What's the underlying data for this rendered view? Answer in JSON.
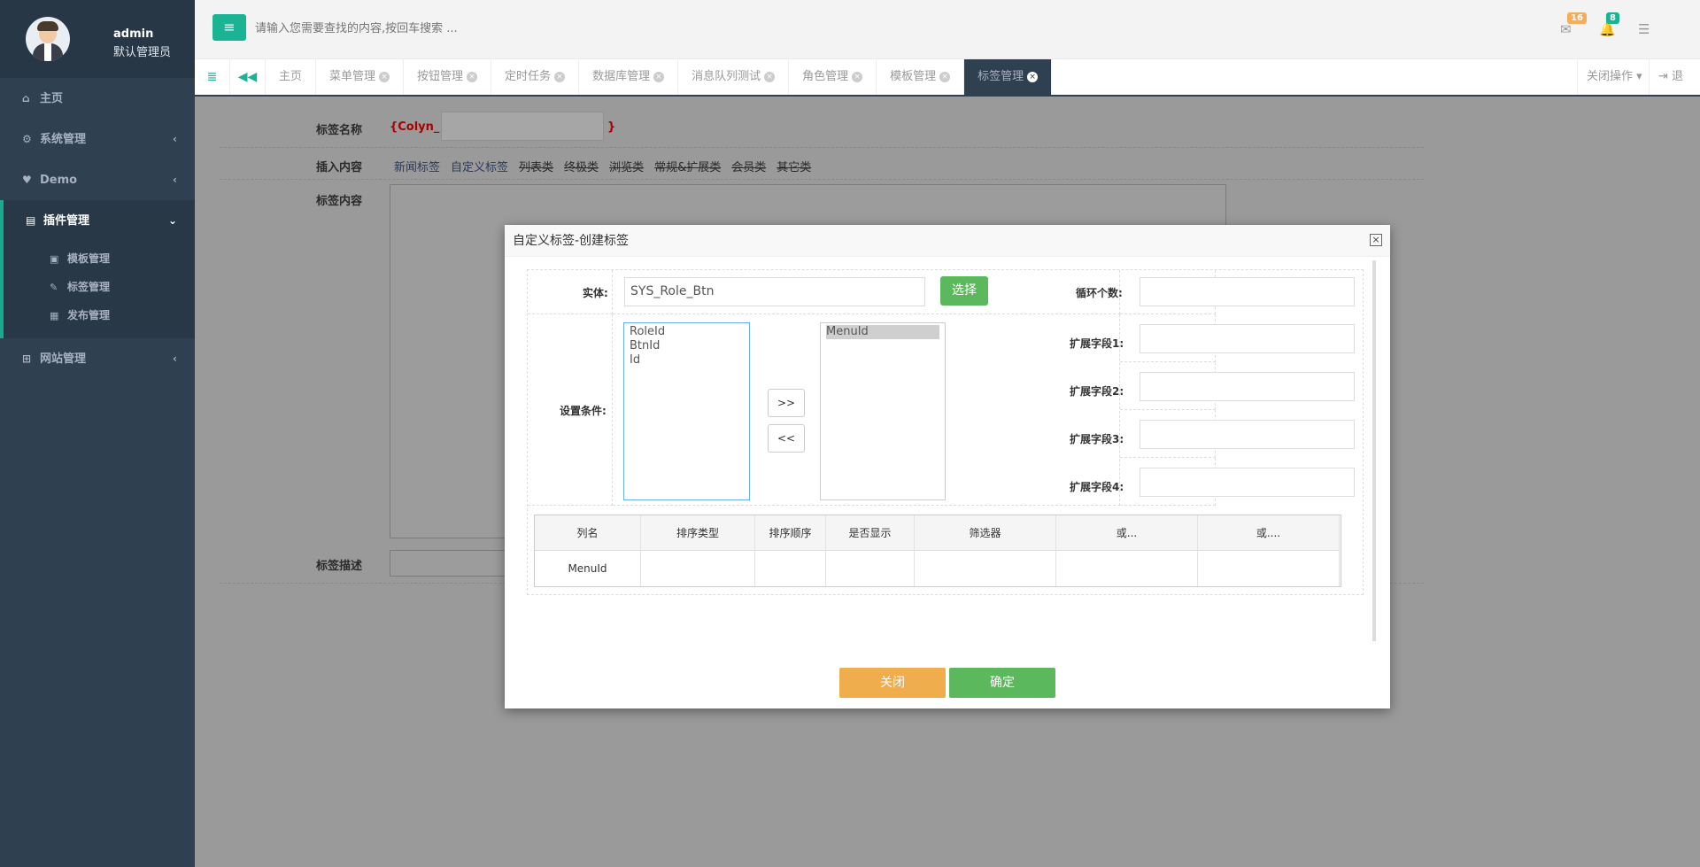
{
  "profile": {
    "name": "admin",
    "role": "默认管理员"
  },
  "sidebar": {
    "items": [
      {
        "label": "主页",
        "icon": "home-icon"
      },
      {
        "label": "系统管理",
        "icon": "gear-icon"
      },
      {
        "label": "Demo",
        "icon": "heart-icon"
      },
      {
        "label": "插件管理",
        "icon": "book-icon"
      },
      {
        "label": "网站管理",
        "icon": "sitemap-icon"
      }
    ],
    "subitems": [
      {
        "label": "模板管理",
        "icon": "template-icon"
      },
      {
        "label": "标签管理",
        "icon": "tag-icon"
      },
      {
        "label": "发布管理",
        "icon": "grid-icon"
      }
    ]
  },
  "topbar": {
    "search_placeholder": "请输入您需要查找的内容,按回车搜索 ...",
    "mail_count": "16",
    "bell_count": "8",
    "badge_colors": {
      "mail": "#f8ac59",
      "bell": "#1ab394"
    }
  },
  "tabs": {
    "items": [
      "主页",
      "菜单管理",
      "按钮管理",
      "定时任务",
      "数据库管理",
      "消息队列测试",
      "角色管理",
      "模板管理",
      "标签管理"
    ],
    "active": "标签管理",
    "close_ops": "关闭操作",
    "logout": "退出"
  },
  "form": {
    "tag_name_label": "标签名称",
    "tag_name_prefix": "{Colyn_",
    "tag_name_suffix": "}",
    "insert_label": "插入内容",
    "insert_links": [
      "新闻标签",
      "自定义标签",
      "列表类",
      "终极类",
      "浏览类",
      "常规&扩展类",
      "会员类",
      "其它类"
    ],
    "content_label": "标签内容",
    "desc_label": "标签描述"
  },
  "modal": {
    "title": "自定义标签-创建标签",
    "entity_label": "实体:",
    "entity_value": "SYS_Role_Btn",
    "select_button": "选择",
    "loop_label": "循环个数:",
    "condition_label": "设置条件:",
    "ext1": "扩展字段1:",
    "ext2": "扩展字段2:",
    "ext3": "扩展字段3:",
    "ext4": "扩展字段4:",
    "left_list": [
      "RoleId",
      "BtnId",
      "Id"
    ],
    "right_list": [
      "MenuId"
    ],
    "move_right": ">>",
    "move_left": "<<",
    "table_headers": [
      "列名",
      "排序类型",
      "排序顺序",
      "是否显示",
      "筛选器",
      "或...",
      "或...."
    ],
    "table_rows": [
      [
        "MenuId",
        "",
        "",
        "",
        "",
        "",
        ""
      ]
    ],
    "close_button": "关闭",
    "ok_button": "确定"
  }
}
